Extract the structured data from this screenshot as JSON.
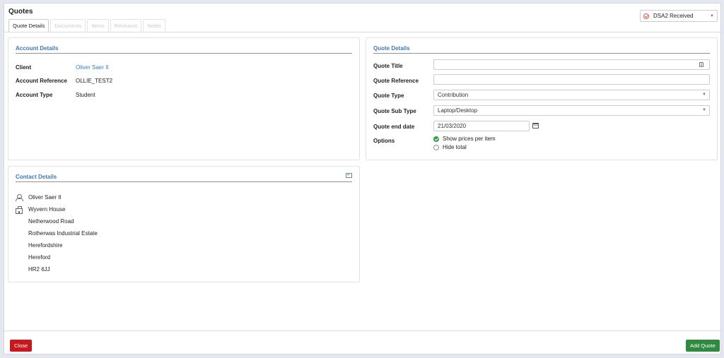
{
  "page": {
    "title": "Quotes"
  },
  "tabs": [
    {
      "label": "Quote Details",
      "active": true
    },
    {
      "label": "Documents",
      "active": false
    },
    {
      "label": "Items",
      "active": false
    },
    {
      "label": "Revisions",
      "active": false
    },
    {
      "label": "Notes",
      "active": false
    }
  ],
  "status": {
    "value": "DSA2 Received",
    "icon": "check-circle-icon",
    "color": "#e0574f"
  },
  "account": {
    "title": "Account Details",
    "client_label": "Client",
    "client_value": "Oliver Saer II",
    "ref_label": "Account Reference",
    "ref_value": "OLLIE_TEST2",
    "type_label": "Account Type",
    "type_value": "Student"
  },
  "contact": {
    "title": "Contact Details",
    "name": "Oliver Saer II",
    "address": [
      "Wyvern House",
      "Netherwood Road",
      "Rotherwas Industrial Estate",
      "Herefordshire",
      "Hereford",
      "HR2 6JJ"
    ]
  },
  "quote": {
    "title": "Quote Details",
    "title_label": "Quote Title",
    "title_value": "",
    "ref_label": "Quote Reference",
    "ref_value": "",
    "type_label": "Quote Type",
    "type_value": "Contribution",
    "subtype_label": "Quote Sub Type",
    "subtype_value": "Laptop/Desktop",
    "end_label": "Quote end date",
    "end_value": "21/03/2020",
    "options_label": "Options",
    "options": [
      {
        "label": "Show prices per item",
        "checked": true
      },
      {
        "label": "Hide total",
        "checked": false
      }
    ]
  },
  "footer": {
    "close_label": "Close",
    "add_label": "Add Quote"
  },
  "colors": {
    "link": "#3d79b6",
    "close": "#c8181d",
    "add": "#2d8a3f",
    "check": "#2e9b47"
  }
}
